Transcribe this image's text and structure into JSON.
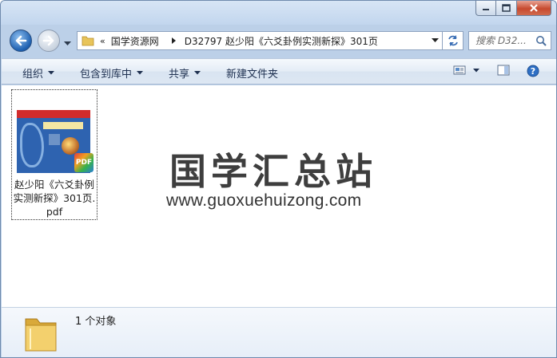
{
  "window": {
    "controls": [
      "minimize-icon",
      "maximize-icon",
      "close-icon"
    ]
  },
  "address": {
    "overflow": "«",
    "crumbs": [
      "国学资源网",
      "D32797 赵少阳《六爻卦例实测新探》301页"
    ]
  },
  "search": {
    "placeholder": "搜索 D32..."
  },
  "toolbar": {
    "organize": "组织",
    "include_in_library": "包含到库中",
    "share": "共享",
    "new_folder": "新建文件夹"
  },
  "files": [
    {
      "name_line1": "赵少阳《六爻卦例",
      "name_line2": "实测新探》301页.",
      "name_line3": "pdf",
      "badge": "PDF",
      "cover_label": "PDF"
    }
  ],
  "watermark": {
    "title": "国学汇总站",
    "url": "www.guoxuehuizong.com"
  },
  "details": {
    "count": "1 个对象"
  },
  "colors": {
    "accent": "#1d5fb0",
    "command_text": "#1e3050"
  }
}
